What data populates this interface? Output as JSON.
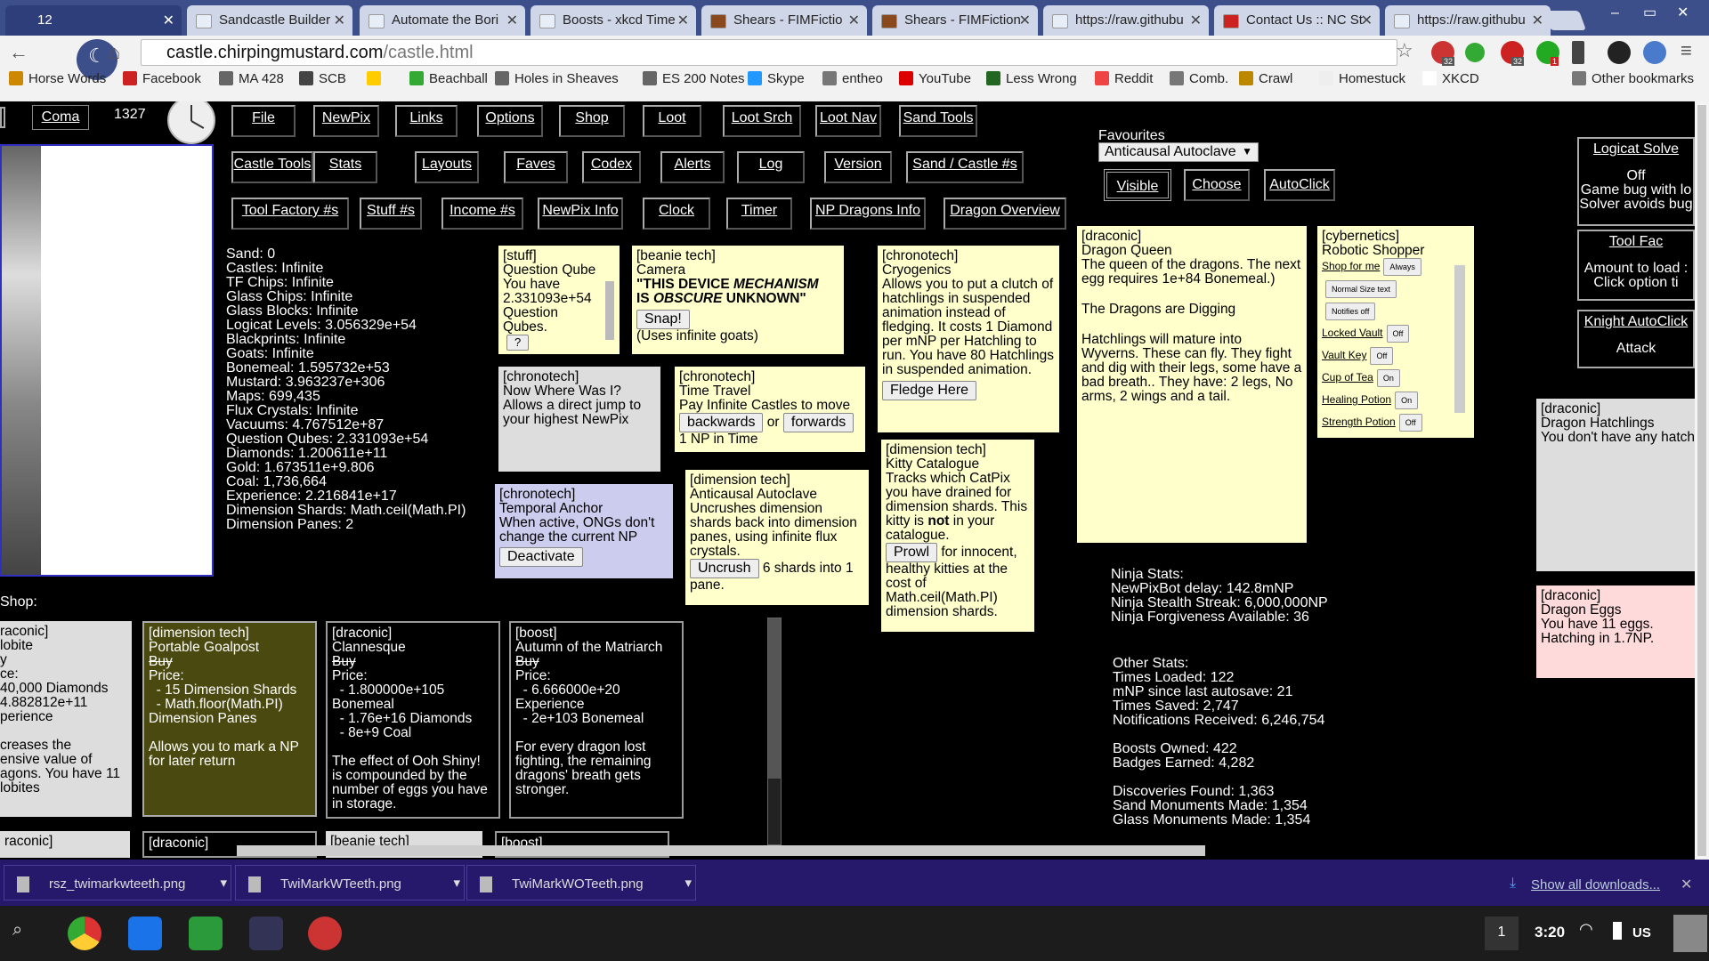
{
  "tabs": [
    {
      "label": "12",
      "active": true
    },
    {
      "label": "Sandcastle Builder"
    },
    {
      "label": "Automate the Bori"
    },
    {
      "label": "Boosts - xkcd Time"
    },
    {
      "label": "Shears - FIMFictio"
    },
    {
      "label": "Shears - FIMFiction"
    },
    {
      "label": "https://raw.githubu"
    },
    {
      "label": "Contact Us :: NC St"
    },
    {
      "label": "https://raw.githubu"
    }
  ],
  "address": {
    "host": "castle.chirpingmustard.com",
    "path": "/castle.html"
  },
  "ext_badges": {
    "one": "32",
    "two": "32",
    "three": "1"
  },
  "bookmarks": [
    "Horse Words",
    "Facebook",
    "MA 428",
    "SCB",
    "",
    "Beachball",
    "Holes in Sheaves",
    "ES 200 Notes",
    "Skype",
    "entheo",
    "YouTube",
    "Less Wrong",
    "Reddit",
    "Comb.",
    "Crawl",
    "Homestuck",
    "XKCD",
    "Other bookmarks"
  ],
  "top": {
    "coma": "Coma",
    "count": "1327"
  },
  "menu_row1": [
    "File",
    "NewPix",
    "Links",
    "Options",
    "Shop",
    "Loot",
    "Loot Srch",
    "Loot Nav",
    "Sand Tools"
  ],
  "menu_row2": [
    "Castle Tools",
    "Stats",
    "Layouts",
    "Faves",
    "Codex",
    "Alerts",
    "Log",
    "Version",
    "Sand / Castle #s"
  ],
  "menu_row3": [
    "Tool Factory #s",
    "Stuff #s",
    "Income #s",
    "NewPix Info",
    "Clock",
    "Timer",
    "NP Dragons Info",
    "Dragon Overview"
  ],
  "favourites": {
    "label": "Favourites",
    "selected": "Anticausal Autoclave",
    "visible": "Visible",
    "choose": "Choose",
    "autoclick": "AutoClick"
  },
  "stuff_stats": "Sand: 0\nCastles: Infinite\nTF Chips: Infinite\nGlass Chips: Infinite\nGlass Blocks: Infinite\nLogicat Levels: 3.056329e+54\nBlackprints: Infinite\nGoats: Infinite\nBonemeal: 1.595732e+53\nMustard: 3.963237e+306\nMaps: 699,435\nFlux Crystals: Infinite\nVacuums: 4.767512e+87\nQuestion Qubes: 2.331093e+54\nDiamonds: 1.200611e+11\nGold: 1.673511e+9.806\nCoal: 1,736,664\nExperience: 2.216841e+17\nDimension Shards: Math.ceil(Math.PI)\nDimension Panes: 2",
  "cards": {
    "qqube": {
      "tag": "[stuff]",
      "title": "Question Qube",
      "body": "You have 2.331093e+54 Question Qubes.",
      "btn": "?"
    },
    "camera": {
      "tag": "[beanie tech]",
      "title": "Camera",
      "quote1": "\"THIS DEVICE ",
      "quote2": "MECHANISM",
      "quote3": "IS ",
      "quote4": "OBSCURE",
      "quote5": " UNKNOWN\"",
      "btn": "Snap!",
      "note": "(Uses infinite goats)"
    },
    "cryo": {
      "tag": "[chronotech]",
      "title": "Cryogenics",
      "body": "Allows you to put a clutch of hatchlings in suspended animation instead of fledging. It costs 1 Diamond per mNP per Hatchling to run. You have 80 Hatchlings in suspended animation.",
      "btn": "Fledge Here"
    },
    "queen": {
      "tag": "[draconic]",
      "title": "Dragon Queen",
      "body": "The queen of the dragons. The next egg requires 1e+84 Bonemeal.)",
      "digging": "The Dragons are Digging",
      "mature": "Hatchlings will mature into Wyverns. These can fly. They fight and dig with their legs, some have a bad breath.. They have: 2 legs, No arms, 2 wings and a tail."
    },
    "robotic": {
      "tag": "[cybernetics]",
      "title": "Robotic Shopper",
      "rows": [
        {
          "label": "Shop for me",
          "val": "Always"
        },
        {
          "label": "",
          "val": "Normal Size text"
        },
        {
          "label": "",
          "val": "Notifies off"
        },
        {
          "label": "Locked Vault",
          "val": "Off"
        },
        {
          "label": "Vault Key",
          "val": "Off"
        },
        {
          "label": "Cup of Tea",
          "val": "On"
        },
        {
          "label": "Healing Potion",
          "val": "On"
        },
        {
          "label": "Strength Potion",
          "val": "Off"
        }
      ]
    },
    "nwwi": {
      "tag": "[chronotech]",
      "title": "Now Where Was I?",
      "body": "Allows a direct jump to your highest NewPix"
    },
    "timetravel": {
      "tag": "[chronotech]",
      "title": "Time Travel",
      "body": "Pay Infinite Castles to move",
      "back": "backwards",
      "or": "or",
      "fwd": "forwards",
      "cost": "1 NP in Time"
    },
    "autoclave": {
      "tag": "[dimension tech]",
      "title": "Anticausal Autoclave",
      "body": "Uncrushes dimension shards back into dimension panes, using infinite flux crystals.",
      "btn": "Uncrush",
      "after": " 6 shards into 1 pane."
    },
    "kitty": {
      "tag": "[dimension tech]",
      "title": "Kitty Catalogue",
      "body1": "Tracks which CatPix you have drained for dimension shards. This kitty is ",
      "not": "not",
      "body2": " in your catalogue.",
      "btn": "Prowl",
      "after": " for innocent, healthy kitties at the cost of Math.ceil(Math.PI) dimension shards."
    },
    "anchor": {
      "tag": "[chronotech]",
      "title": "Temporal Anchor",
      "body": "When active, ONGs don't change the current NP",
      "btn": "Deactivate"
    },
    "hatch": {
      "tag": "[draconic]",
      "title": "Dragon Hatchlings",
      "body": "You don't have any hatchlings at the mome"
    },
    "eggs": {
      "tag": "[draconic]",
      "title": "Dragon Eggs",
      "body": "You have 11 eggs. Hatching in 1.7NP."
    }
  },
  "side": {
    "logicat": {
      "title": "Logicat Solve",
      "l1": "Off",
      "l2": "Game bug with lo",
      "l3": "Solver avoids bug"
    },
    "toolfac": {
      "title": "Tool Fac",
      "l1": "Amount to load :",
      "l2": "Click option ti"
    },
    "knight": {
      "title": "Knight AutoClick",
      "l1": "Attack"
    }
  },
  "ninja": "Ninja Stats:\nNewPixBot delay: 142.8mNP\nNinja Stealth Streak: 6,000,000NP\nNinja Forgiveness Available: 36",
  "other": "Other Stats:\nTimes Loaded: 122\nmNP since last autosave: 21\nTimes Saved: 2,747\nNotifications Received: 6,246,754\n\nBoosts Owned: 422\nBadges Earned: 4,282\n\nDiscoveries Found: 1,363\nSand Monuments Made: 1,354\nGlass Monuments Made: 1,354",
  "shop": {
    "label": "Shop:",
    "c0": "raconic]\nlobite\ny\nce:\n40,000 Diamonds\n4.882812e+11\nperience\n\ncreases the\nensive value of\nagons. You have 11\nlobites",
    "c1": {
      "tag": "[dimension tech]",
      "title": "Portable Goalpost",
      "buy": "Buy",
      "price": "Price:\n  - 15 Dimension Shards\n  - Math.floor(Math.PI)\nDimension Panes",
      "desc": "Allows you to mark a NP for later return"
    },
    "c2": {
      "tag": "[draconic]",
      "title": "Clannesque",
      "buy": "Buy",
      "price": "Price:\n  - 1.800000e+105\nBonemeal\n  - 1.76e+16 Diamonds\n  - 8e+9 Coal",
      "desc": "The effect of Ooh Shiny! is compounded by the number of eggs you have in storage."
    },
    "c3": {
      "tag": "[boost]",
      "title": "Autumn of the Matriarch",
      "buy": "Buy",
      "price": "Price:\n  - 6.666000e+20\nExperience\n  - 2e+103 Bonemeal",
      "desc": "For every dragon lost fighting, the remaining dragons' breath gets stronger."
    },
    "peek": [
      "raconic]",
      "[draconic]",
      "[beanie tech]",
      "[boost]"
    ]
  },
  "downloads": {
    "files": [
      "rsz_twimarkwteeth.png",
      "TwiMarkWTeeth.png",
      "TwiMarkWOTeeth.png"
    ],
    "show_all": "Show all downloads..."
  },
  "shelf": {
    "notif": "1",
    "time": "3:20",
    "locale": "US"
  }
}
